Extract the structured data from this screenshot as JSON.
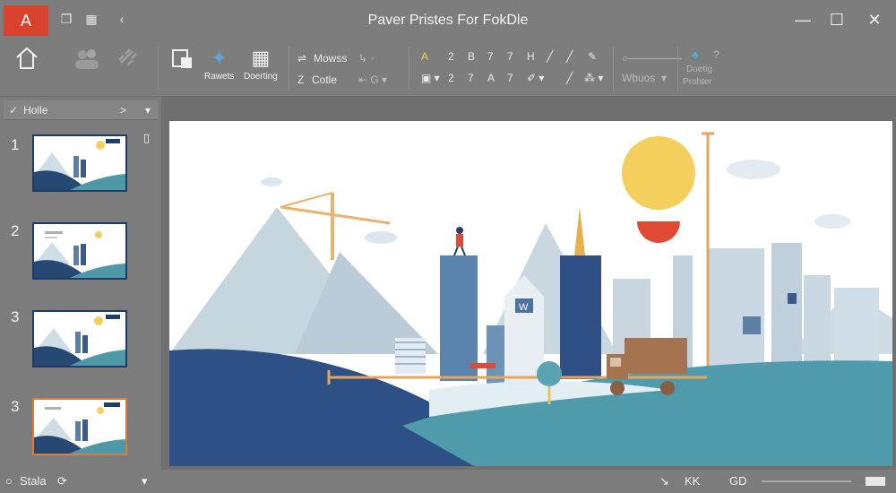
{
  "app": {
    "badge": "A",
    "title": "Paver Pristes For FokDle"
  },
  "titlebar_icons": [
    "copy-icon",
    "grid-icon",
    "back-icon"
  ],
  "window_controls": {
    "minimize": "—",
    "maximize": "☐",
    "close": "✕"
  },
  "ribbon": {
    "home_icon": "house-icon",
    "insert_label": "Rawets",
    "drawing_label": "Doerting",
    "small_1": "Mowss",
    "small_2": "Cotle",
    "font_row_1": [
      "A",
      "2",
      "B",
      "7",
      "7",
      "H"
    ],
    "font_row_2": [
      "2",
      "7",
      "A",
      "7"
    ],
    "right_1": "Wbuos",
    "right_2": "Doetig",
    "right_3": "Prohter"
  },
  "sidebar": {
    "header": "Holle",
    "slides": [
      {
        "num": "1"
      },
      {
        "num": "2"
      },
      {
        "num": "3"
      },
      {
        "num": "3"
      }
    ],
    "selected_index": 3
  },
  "slide": {
    "accent_sun": "#f5cf5d",
    "accent_red": "#e04a35",
    "sign_text": "W"
  },
  "status": {
    "left_label": "Stala",
    "view_1": "KK",
    "view_2": "GD"
  }
}
